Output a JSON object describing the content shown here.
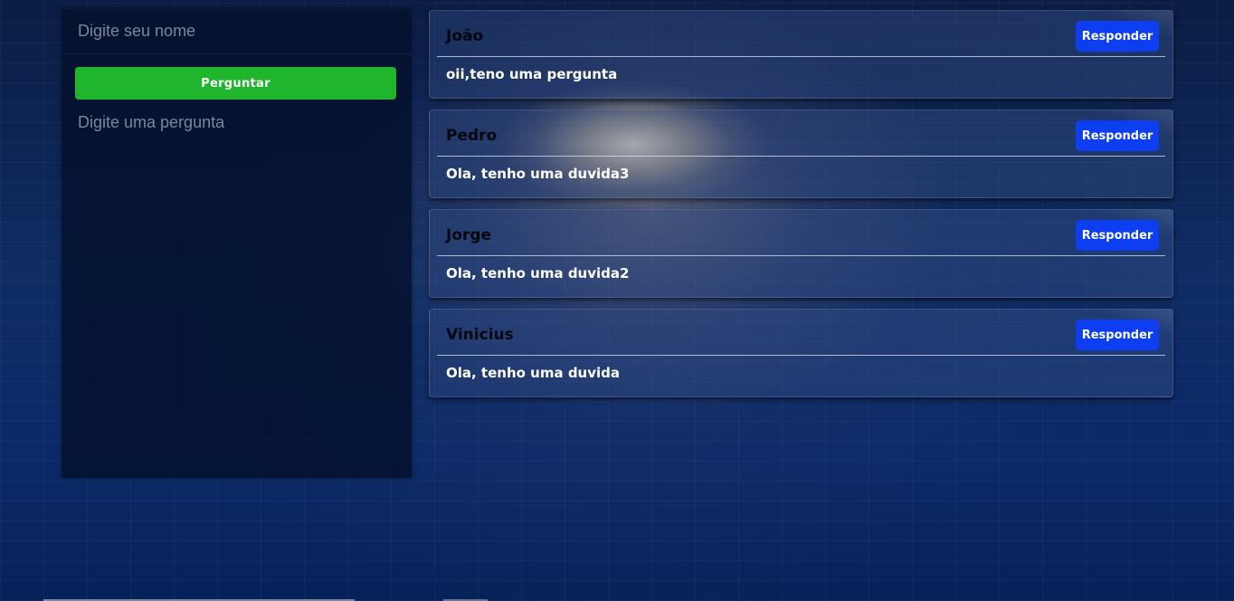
{
  "form": {
    "name_placeholder": "Digite seu nome",
    "name_value": "",
    "ask_label": "Perguntar",
    "question_placeholder": "Digite uma pergunta",
    "question_value": ""
  },
  "questions": [
    {
      "name": "João",
      "text": "oii,teno uma pergunta",
      "reply_label": "Responder"
    },
    {
      "name": "Pedro",
      "text": "Ola, tenho uma duvida3",
      "reply_label": "Responder"
    },
    {
      "name": "Jorge",
      "text": "Ola, tenho uma duvida2",
      "reply_label": "Responder"
    },
    {
      "name": "Vinicius",
      "text": "Ola, tenho uma duvida",
      "reply_label": "Responder"
    }
  ],
  "colors": {
    "ask_button": "#1fb52d",
    "reply_button": "#0d3ef2",
    "background": "#0c2048"
  }
}
